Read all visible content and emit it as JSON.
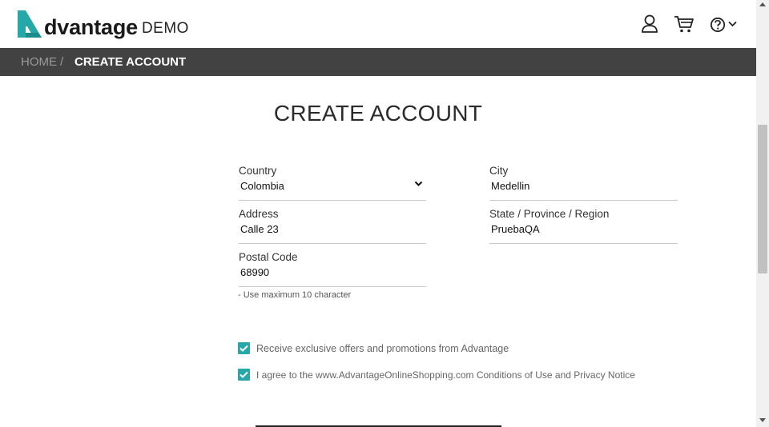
{
  "header": {
    "logo_main": "dvantage",
    "logo_demo": "DEMO",
    "icons": [
      "user-icon",
      "cart-icon",
      "help-icon",
      "chevron-down-icon"
    ]
  },
  "breadcrumb": {
    "home": "HOME",
    "separator": "/",
    "current": "CREATE ACCOUNT"
  },
  "form": {
    "title": "CREATE ACCOUNT",
    "country": {
      "label": "Country",
      "value": "Colombia"
    },
    "city": {
      "label": "City",
      "value": "Medellin"
    },
    "address": {
      "label": "Address",
      "value": "Calle 23"
    },
    "state": {
      "label": "State / Province / Region",
      "value": "PruebaQA"
    },
    "postal": {
      "label": "Postal Code",
      "value": "68990"
    },
    "postal_hint": "- Use maximum 10 character",
    "offers_label": "Receive exclusive offers and promotions from Advantage",
    "agree_label": "I agree to the www.AdvantageOnlineShopping.com Conditions of Use and Privacy Notice",
    "offers_checked": true,
    "agree_checked": true
  },
  "colors": {
    "brand_teal": "#26a8a8",
    "breadcrumb_bar": "#424242"
  }
}
